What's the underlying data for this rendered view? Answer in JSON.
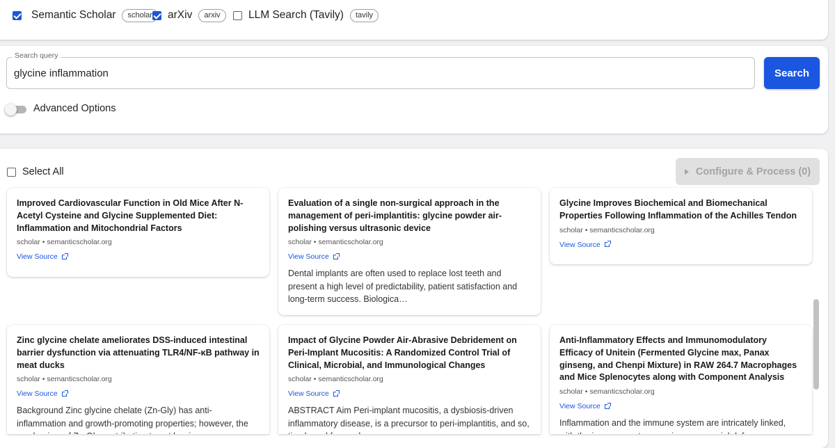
{
  "sources": [
    {
      "label": "Semantic Scholar",
      "tag": "scholar",
      "checked": true
    },
    {
      "label": "arXiv",
      "tag": "arxiv",
      "checked": true
    },
    {
      "label": "LLM Search (Tavily)",
      "tag": "tavily",
      "checked": false
    }
  ],
  "search": {
    "legend": "Search query",
    "value": "glycine inflammation",
    "button_label": "Search",
    "advanced_label": "Advanced Options"
  },
  "results": {
    "select_all_label": "Select All",
    "configure_label": "Configure & Process (0)",
    "view_source_label": "View Source",
    "cards": [
      {
        "title": "Improved Cardiovascular Function in Old Mice After N-Acetyl Cysteine and Glycine Supplemented Diet: Inflammation and Mitochondrial Factors",
        "source": "scholar",
        "domain": "semanticscholar.org",
        "abstract": ""
      },
      {
        "title": "Evaluation of a single non-surgical approach in the management of peri-implantitis: glycine powder air-polishing versus ultrasonic device",
        "source": "scholar",
        "domain": "semanticscholar.org",
        "abstract": "Dental implants are often used to replace lost teeth and present a high level of predictability, patient satisfaction and long-term success. Biologica…"
      },
      {
        "title": "Glycine Improves Biochemical and Biomechanical Properties Following Inflammation of the Achilles Tendon",
        "source": "scholar",
        "domain": "semanticscholar.org",
        "abstract": ""
      },
      {
        "title": "Zinc glycine chelate ameliorates DSS-induced intestinal barrier dysfunction via attenuating TLR4/NF-κB pathway in meat ducks",
        "source": "scholar",
        "domain": "semanticscholar.org",
        "abstract": "Background Zinc glycine chelate (Zn-Gly) has anti-inflammation and growth-promoting properties; however, the mechanism of Zn-Gly contributing to gut barrier…"
      },
      {
        "title": "Impact of Glycine Powder Air-Abrasive Debridement on Peri-Implant Mucositis: A Randomized Control Trial of Clinical, Microbial, and Immunological Changes",
        "source": "scholar",
        "domain": "semanticscholar.org",
        "abstract": "ABSTRACT Aim Peri-implant mucositis, a dysbiosis-driven inflammatory disease, is a precursor to peri-implantitis, and so, timely and focused…"
      },
      {
        "title": "Anti-Inflammatory Effects and Immunomodulatory Efficacy of Unitein (Fermented Glycine max, Panax ginseng, and Chenpi Mixture) in RAW 264.7 Macrophages and Mice Splenocytes along with Component Analysis",
        "source": "scholar",
        "domain": "semanticscholar.org",
        "abstract": "Inflammation and the immune system are intricately linked, with the immune system serving as a crucial defense mechanism in the body…"
      }
    ]
  },
  "colors": {
    "accent": "#1a56e0",
    "disabled_bg": "#e0e0e0",
    "disabled_text": "#a3a3a3",
    "page_bg": "#f1f1f3"
  }
}
